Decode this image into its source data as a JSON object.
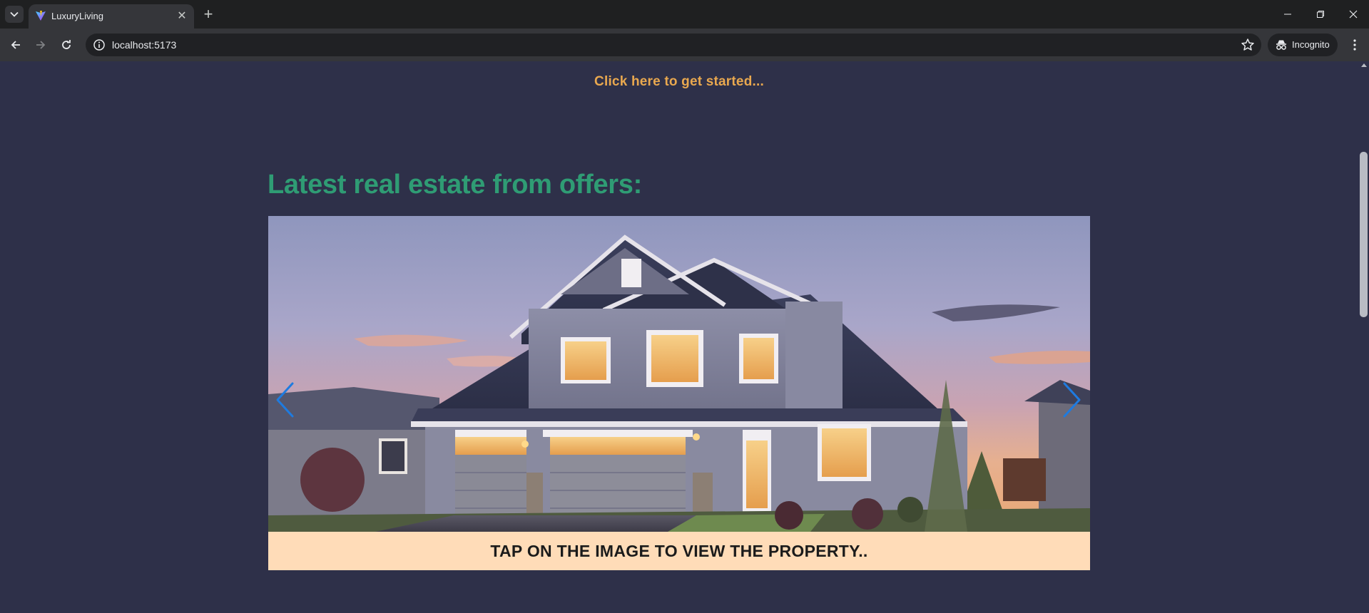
{
  "browser": {
    "tab": {
      "title": "LuxuryLiving",
      "favicon": "vite-logo-icon"
    },
    "address_bar": {
      "url": "localhost:5173"
    },
    "incognito_label": "Incognito",
    "window_controls": [
      "minimize",
      "restore",
      "close"
    ]
  },
  "page": {
    "cta_text": "Click here to get started...",
    "section_title": "Latest real estate from offers:",
    "carousel": {
      "image_subject": "house-photo",
      "prev_icon": "chevron-left-icon",
      "next_icon": "chevron-right-icon"
    },
    "caption": "TAP ON THE IMAGE TO VIEW THE PROPERTY.."
  },
  "colors": {
    "page_background": "#2e3049",
    "cta": "#e9a84f",
    "title": "#2f9c74",
    "caption_background": "#ffdcb8",
    "carousel_arrow": "#1e7be0"
  }
}
